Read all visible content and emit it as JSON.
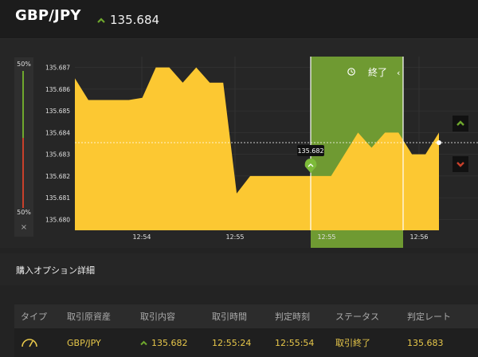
{
  "header": {
    "pair": "GBP/JPY",
    "price": "135.684",
    "direction_icon": "up-arrow-icon"
  },
  "meter": {
    "top_label": "50%",
    "bottom_label": "50%",
    "close_label": "×"
  },
  "chart": {
    "y_ticks": [
      "135.687",
      "135.686",
      "135.685",
      "135.684",
      "135.683",
      "135.682",
      "135.681",
      "135.680"
    ],
    "x_ticks": [
      "12:54",
      "12:55",
      "12:55",
      "12:56"
    ],
    "current_value": "135.684",
    "entry_label": "135.682",
    "panel_label": "終了",
    "panel_icon": "history-icon",
    "colors": {
      "area": "#fcc832",
      "panel": "#6f9a32",
      "up": "#6fa82d",
      "down": "#c8402b"
    }
  },
  "chart_data": {
    "type": "area",
    "title": "",
    "xlabel": "",
    "ylabel": "",
    "x_ticks": [
      "12:54",
      "12:55",
      "12:55",
      "12:56"
    ],
    "ylim": [
      135.6795,
      135.6875
    ],
    "series": [
      {
        "values": [
          135.6865,
          135.6855,
          135.6855,
          135.6855,
          135.6855,
          135.6856,
          135.687,
          135.687,
          135.6863,
          135.687,
          135.6863,
          135.6863,
          135.6812,
          135.682,
          135.682,
          135.682,
          135.682,
          135.682,
          135.682,
          135.682,
          135.683,
          135.684,
          135.6833,
          135.684,
          135.684,
          135.683,
          135.683,
          135.684
        ]
      }
    ]
  },
  "side_buttons": {
    "up": "up-arrow-icon",
    "down": "down-arrow-icon"
  },
  "details": {
    "title": "購入オプション詳細",
    "headers": [
      "タイプ",
      "取引原資産",
      "取引内容",
      "取引時間",
      "判定時刻",
      "ステータス",
      "判定レート"
    ],
    "row": {
      "type_icon": "gauge-icon",
      "asset": "GBP/JPY",
      "content": "135.682",
      "trade_time": "12:55:24",
      "judge_time": "12:55:54",
      "status": "取引終了",
      "rate": "135.683"
    }
  }
}
